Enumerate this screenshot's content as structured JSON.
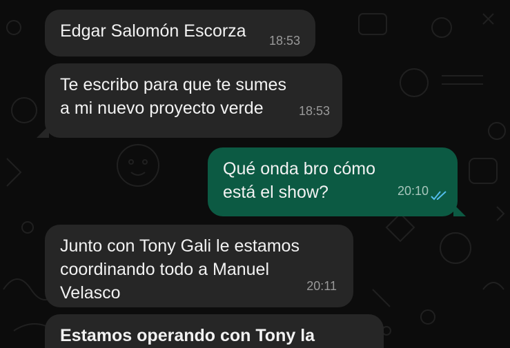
{
  "colors": {
    "background": "#0c0c0c",
    "incoming_bubble": "#262626",
    "outgoing_bubble": "#0c5a43",
    "read_ticks": "#53bdeb"
  },
  "messages": [
    {
      "direction": "incoming",
      "lines": [
        "Edgar Salomón Escorza"
      ],
      "time": "18:53"
    },
    {
      "direction": "incoming",
      "lines": [
        "Te escribo para que te sumes",
        "a mi nuevo proyecto verde"
      ],
      "time": "18:53"
    },
    {
      "direction": "outgoing",
      "lines": [
        "Qué onda bro cómo",
        "está el show?"
      ],
      "time": "20:10",
      "status_icon": "double-check-read-icon"
    },
    {
      "direction": "incoming",
      "lines": [
        "Junto con Tony Gali le estamos",
        "coordinando todo a Manuel",
        "Velasco"
      ],
      "time": "20:11"
    },
    {
      "direction": "incoming",
      "lines": [
        "Estamos operando con Tony la"
      ],
      "time": ""
    }
  ]
}
